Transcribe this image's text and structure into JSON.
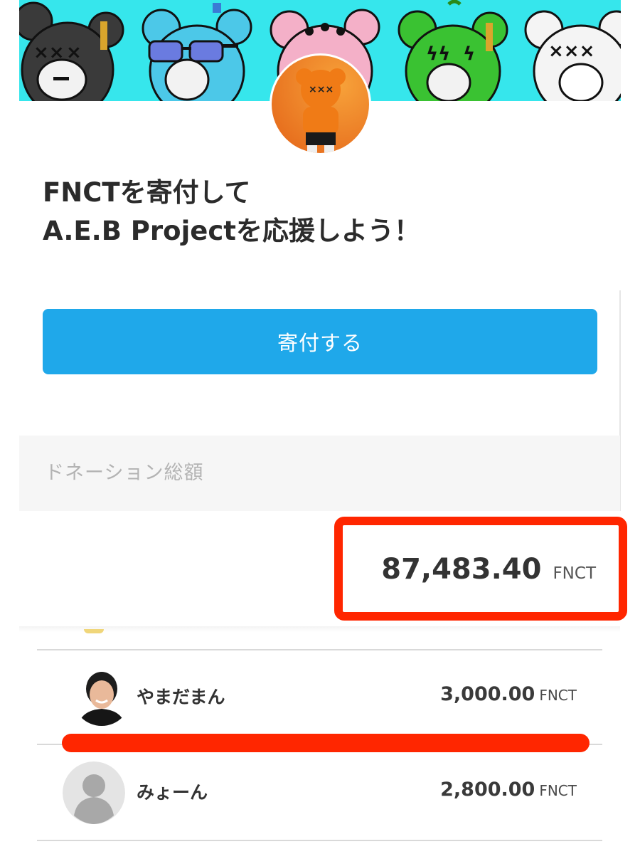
{
  "project": {
    "banner_image": "bear-characters-banner",
    "avatar_image": "orange-bear-figure",
    "heading_line1": "FNCTを寄付して",
    "heading_line2": "A.E.B Projectを応援しよう！"
  },
  "donate_button": {
    "label": "寄付する"
  },
  "total": {
    "label": "ドネーション総額",
    "amount": "87,483.40",
    "unit": "FNCT"
  },
  "donors": [
    {
      "name": "やまだまん",
      "amount": "3,000.00",
      "unit": "FNCT",
      "avatar": "user-photo"
    },
    {
      "name": "みょーん",
      "amount": "2,800.00",
      "unit": "FNCT",
      "avatar": "default-user-icon"
    }
  ],
  "colors": {
    "accent": "#1fa8ea",
    "banner_bg": "#36e6ec",
    "highlight": "#ff2600",
    "section_bg": "#f6f6f6"
  }
}
